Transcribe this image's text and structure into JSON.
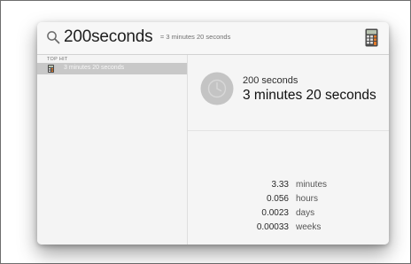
{
  "search": {
    "query": "200seconds",
    "inline_hint": "= 3 minutes 20 seconds",
    "search_icon": "search-icon",
    "app_icon": "calculator-icon"
  },
  "results": {
    "section_label": "TOP HIT",
    "top_hit": {
      "label": "3 minutes 20 seconds",
      "icon": "calculator-icon"
    }
  },
  "preview": {
    "icon": "clock-icon",
    "input_text": "200 seconds",
    "result_text": "3 minutes 20 seconds",
    "conversions": [
      {
        "value": "3.33",
        "unit": "minutes"
      },
      {
        "value": "0.056",
        "unit": "hours"
      },
      {
        "value": "0.0023",
        "unit": "days"
      },
      {
        "value": "0.00033",
        "unit": "weeks"
      }
    ]
  },
  "colors": {
    "selection": "#c8c8c8",
    "panel": "#f3f3f3",
    "calculator_orange": "#e0792a"
  }
}
